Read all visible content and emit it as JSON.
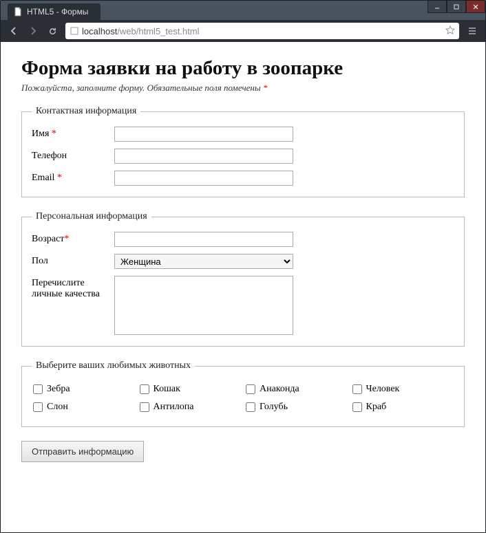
{
  "browser": {
    "tab_title": "HTML5 - Формы",
    "url_host": "localhost",
    "url_path": "/web/html5_test.html"
  },
  "page": {
    "heading": "Форма заявки на работу в зоопарке",
    "subtitle_prefix": "Пожалуйста, заполните форму. Обязательные поля помечены ",
    "required_mark": "*"
  },
  "fieldsets": {
    "contact": {
      "legend": "Контактная информация",
      "fields": {
        "name": {
          "label": "Имя",
          "required": true,
          "value": ""
        },
        "phone": {
          "label": "Телефон",
          "required": false,
          "value": ""
        },
        "email": {
          "label": "Email",
          "required": true,
          "value": ""
        }
      }
    },
    "personal": {
      "legend": "Персональная информация",
      "fields": {
        "age": {
          "label": "Возраст",
          "required": true,
          "value": ""
        },
        "gender": {
          "label": "Пол",
          "required": false,
          "selected": "Женщина"
        },
        "qualities": {
          "label": "Перечислите личные качества",
          "required": false,
          "value": ""
        }
      }
    },
    "animals": {
      "legend": "Выберите ваших любимых животных",
      "items": [
        {
          "label": "Зебра"
        },
        {
          "label": "Кошак"
        },
        {
          "label": "Анаконда"
        },
        {
          "label": "Человек"
        },
        {
          "label": "Слон"
        },
        {
          "label": "Антилопа"
        },
        {
          "label": "Голубь"
        },
        {
          "label": "Краб"
        }
      ]
    }
  },
  "submit_label": "Отправить информацию"
}
